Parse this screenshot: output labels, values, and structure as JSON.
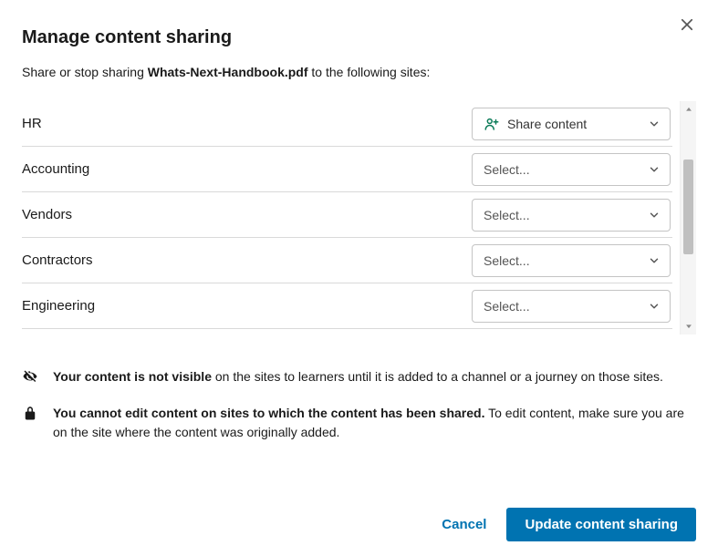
{
  "dialog": {
    "title": "Manage content sharing",
    "subtitle_prefix": "Share or stop sharing ",
    "filename": "Whats-Next-Handbook.pdf",
    "subtitle_suffix": " to the following sites:"
  },
  "share_label": "Share content",
  "select_placeholder": "Select...",
  "sites": [
    {
      "name": "HR",
      "selection": "share"
    },
    {
      "name": "Accounting",
      "selection": "none"
    },
    {
      "name": "Vendors",
      "selection": "none"
    },
    {
      "name": "Contractors",
      "selection": "none"
    },
    {
      "name": "Engineering",
      "selection": "none"
    }
  ],
  "notes": {
    "visibility_bold": "Your content is not visible",
    "visibility_rest": " on the sites to learners until it is added to a channel or a journey on those sites.",
    "edit_bold": "You cannot edit content on sites to which the content has been shared.",
    "edit_rest": " To edit content, make sure you are on the site where the content was originally added."
  },
  "footer": {
    "cancel": "Cancel",
    "submit": "Update content sharing"
  }
}
